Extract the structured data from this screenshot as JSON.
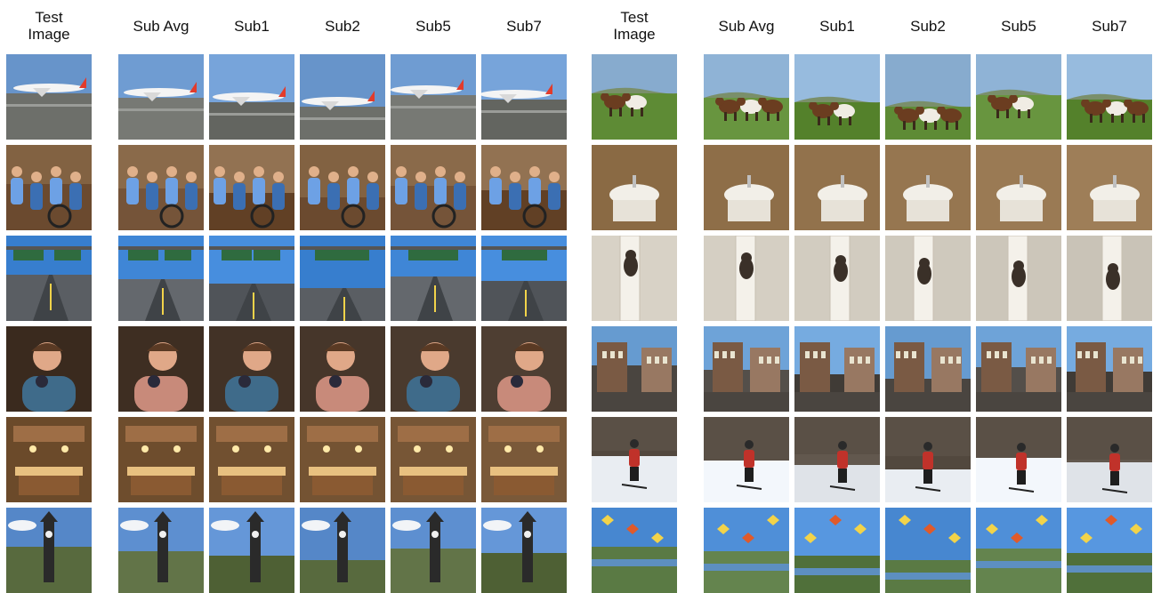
{
  "left_group": {
    "headers": [
      "Test\nImage",
      "Sub Avg",
      "Sub1",
      "Sub2",
      "Sub5",
      "Sub7"
    ],
    "rows": [
      {
        "scene": "airplane",
        "sky": "#6f9cd2",
        "ground": "#6d6f6a",
        "accent": "#e23b2b"
      },
      {
        "scene": "people",
        "sky": "#8a6a4a",
        "ground": "#6b4a2f",
        "accent": "#3b6fb3"
      },
      {
        "scene": "highway",
        "sky": "#3f86d6",
        "ground": "#5a5e63",
        "accent": "#2f6b3f"
      },
      {
        "scene": "portrait",
        "sky": "#3a2a1e",
        "ground": "#7a5a44",
        "accent": "#e0a888"
      },
      {
        "scene": "kitchen",
        "sky": "#6b4a2a",
        "ground": "#8a5a32",
        "accent": "#e8c080"
      },
      {
        "scene": "tower",
        "sky": "#5d8fd0",
        "ground": "#586a3e",
        "accent": "#2a2a2a"
      }
    ]
  },
  "right_group": {
    "headers": [
      "Test\nImage",
      "Sub Avg",
      "Sub1",
      "Sub2",
      "Sub5",
      "Sub7"
    ],
    "rows": [
      {
        "scene": "cows",
        "sky": "#8fb3d6",
        "ground": "#5e8b35",
        "accent": "#6b3d20"
      },
      {
        "scene": "bathroom",
        "sky": "#8a6a44",
        "ground": "#6e5236",
        "accent": "#f2efe8"
      },
      {
        "scene": "doorcat",
        "sky": "#d8d2c6",
        "ground": "#b9b0a2",
        "accent": "#3a3028"
      },
      {
        "scene": "street",
        "sky": "#6ea3d8",
        "ground": "#4a4540",
        "accent": "#7a5a44"
      },
      {
        "scene": "skier",
        "sky": "#5a5046",
        "ground": "#e9edf2",
        "accent": "#c0322a"
      },
      {
        "scene": "kites",
        "sky": "#4f8fd8",
        "ground": "#5a7a44",
        "accent": "#e05a2a"
      }
    ]
  }
}
